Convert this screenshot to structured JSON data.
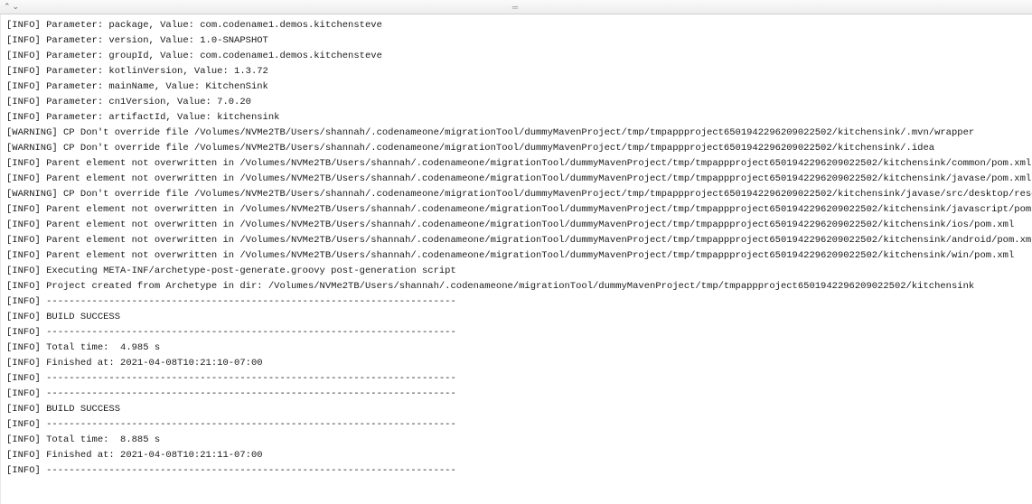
{
  "toolbar": {
    "up_icon": "⌃",
    "down_icon": "⌄",
    "handle": "═"
  },
  "log": {
    "lines": [
      "[INFO] Parameter: package, Value: com.codename1.demos.kitchensteve",
      "[INFO] Parameter: version, Value: 1.0-SNAPSHOT",
      "[INFO] Parameter: groupId, Value: com.codename1.demos.kitchensteve",
      "[INFO] Parameter: kotlinVersion, Value: 1.3.72",
      "[INFO] Parameter: mainName, Value: KitchenSink",
      "[INFO] Parameter: cn1Version, Value: 7.0.20",
      "[INFO] Parameter: artifactId, Value: kitchensink",
      "[WARNING] CP Don't override file /Volumes/NVMe2TB/Users/shannah/.codenameone/migrationTool/dummyMavenProject/tmp/tmpappproject6501942296209022502/kitchensink/.mvn/wrapper",
      "[WARNING] CP Don't override file /Volumes/NVMe2TB/Users/shannah/.codenameone/migrationTool/dummyMavenProject/tmp/tmpappproject6501942296209022502/kitchensink/.idea",
      "[INFO] Parent element not overwritten in /Volumes/NVMe2TB/Users/shannah/.codenameone/migrationTool/dummyMavenProject/tmp/tmpappproject6501942296209022502/kitchensink/common/pom.xml",
      "[INFO] Parent element not overwritten in /Volumes/NVMe2TB/Users/shannah/.codenameone/migrationTool/dummyMavenProject/tmp/tmpappproject6501942296209022502/kitchensink/javase/pom.xml",
      "[WARNING] CP Don't override file /Volumes/NVMe2TB/Users/shannah/.codenameone/migrationTool/dummyMavenProject/tmp/tmpappproject6501942296209022502/kitchensink/javase/src/desktop/resources",
      "[INFO] Parent element not overwritten in /Volumes/NVMe2TB/Users/shannah/.codenameone/migrationTool/dummyMavenProject/tmp/tmpappproject6501942296209022502/kitchensink/javascript/pom.xml",
      "[INFO] Parent element not overwritten in /Volumes/NVMe2TB/Users/shannah/.codenameone/migrationTool/dummyMavenProject/tmp/tmpappproject6501942296209022502/kitchensink/ios/pom.xml",
      "[INFO] Parent element not overwritten in /Volumes/NVMe2TB/Users/shannah/.codenameone/migrationTool/dummyMavenProject/tmp/tmpappproject6501942296209022502/kitchensink/android/pom.xml",
      "[INFO] Parent element not overwritten in /Volumes/NVMe2TB/Users/shannah/.codenameone/migrationTool/dummyMavenProject/tmp/tmpappproject6501942296209022502/kitchensink/win/pom.xml",
      "[INFO] Executing META-INF/archetype-post-generate.groovy post-generation script",
      "[INFO] Project created from Archetype in dir: /Volumes/NVMe2TB/Users/shannah/.codenameone/migrationTool/dummyMavenProject/tmp/tmpappproject6501942296209022502/kitchensink",
      "[INFO] ------------------------------------------------------------------------",
      "[INFO] BUILD SUCCESS",
      "[INFO] ------------------------------------------------------------------------",
      "[INFO] Total time:  4.985 s",
      "[INFO] Finished at: 2021-04-08T10:21:10-07:00",
      "[INFO] ------------------------------------------------------------------------",
      "[INFO] ------------------------------------------------------------------------",
      "[INFO] BUILD SUCCESS",
      "[INFO] ------------------------------------------------------------------------",
      "[INFO] Total time:  8.885 s",
      "[INFO] Finished at: 2021-04-08T10:21:11-07:00",
      "[INFO] ------------------------------------------------------------------------"
    ]
  }
}
